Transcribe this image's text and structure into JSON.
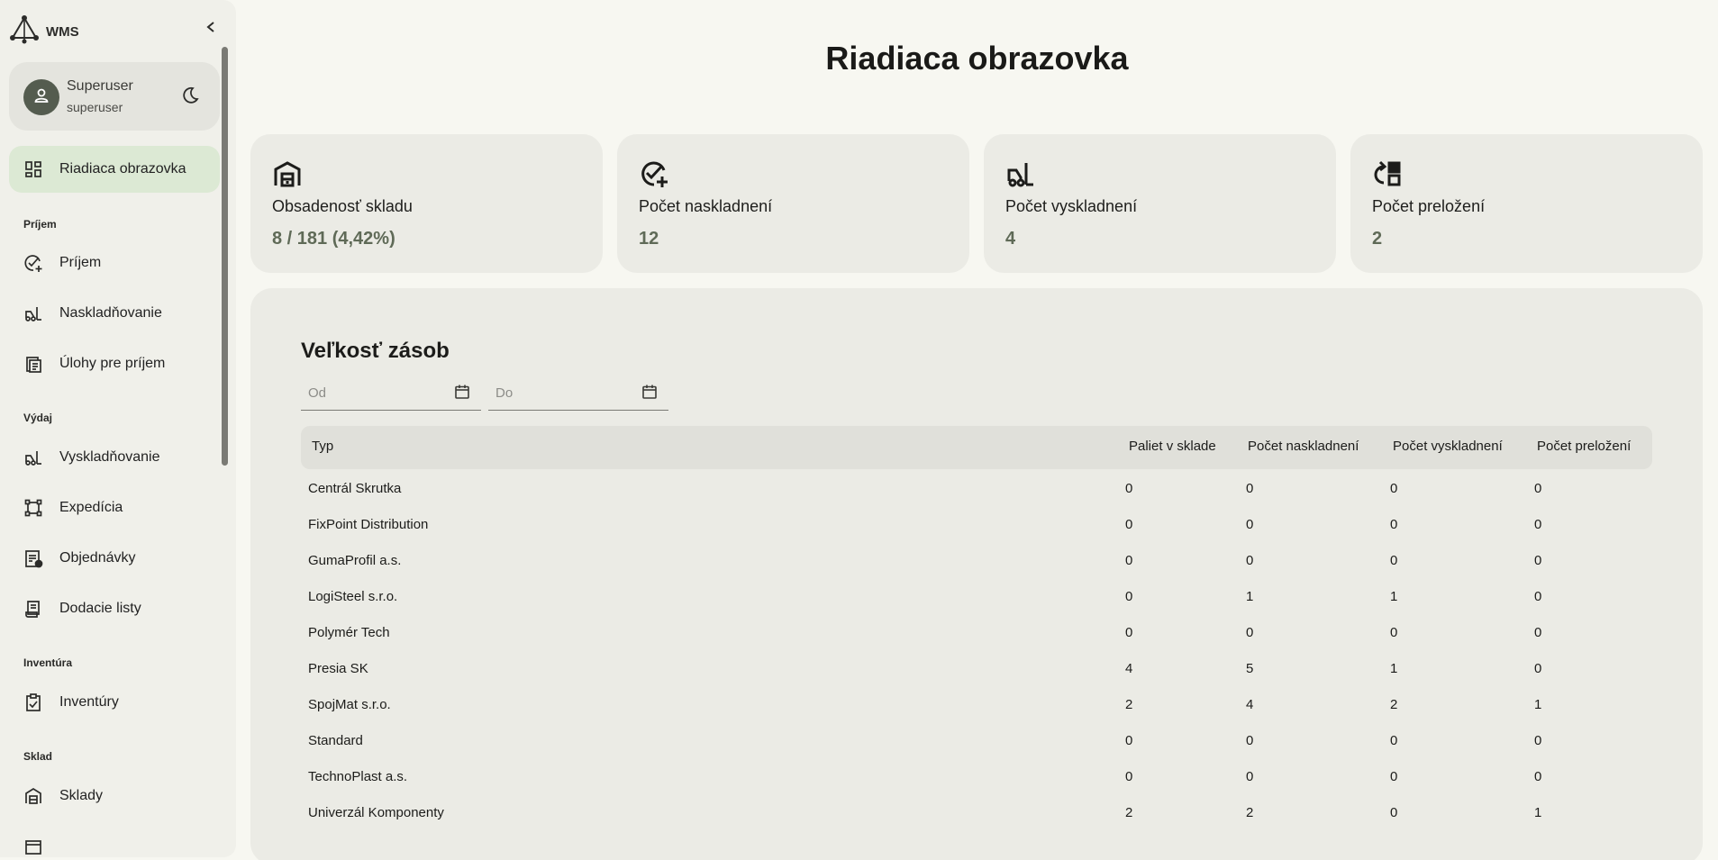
{
  "app": {
    "brand": "WMS"
  },
  "user": {
    "name": "Superuser",
    "login": "superuser"
  },
  "nav": {
    "dashboard": "Riadiaca obrazovka",
    "section_prijem": "Príjem",
    "prijem": "Príjem",
    "naskladnovanie": "Naskladňovanie",
    "ulohy": "Úlohy pre príjem",
    "section_vydaj": "Výdaj",
    "vyskladnovanie": "Vyskladňovanie",
    "expedicia": "Expedícia",
    "objednavky": "Objednávky",
    "dodacie": "Dodacie listy",
    "section_inventura": "Inventúra",
    "inventury": "Inventúry",
    "section_sklad": "Sklad",
    "sklady": "Sklady"
  },
  "page": {
    "title": "Riadiaca obrazovka"
  },
  "stats": [
    {
      "label": "Obsadenosť skladu",
      "value": "8 / 181 (4,42%)",
      "icon": "warehouse-icon"
    },
    {
      "label": "Počet naskladnení",
      "value": "12",
      "icon": "check-add-icon"
    },
    {
      "label": "Počet vyskladnení",
      "value": "4",
      "icon": "forklift-icon"
    },
    {
      "label": "Počet preložení",
      "value": "2",
      "icon": "relocate-icon"
    }
  ],
  "stock": {
    "title": "Veľkosť zásob",
    "from_placeholder": "Od",
    "to_placeholder": "Do",
    "columns": [
      "Typ",
      "Paliet v sklade",
      "Počet naskladnení",
      "Počet vyskladnení",
      "Počet preložení"
    ],
    "rows": [
      [
        "Centrál Skrutka",
        "0",
        "0",
        "0",
        "0"
      ],
      [
        "FixPoint Distribution",
        "0",
        "0",
        "0",
        "0"
      ],
      [
        "GumaProfil a.s.",
        "0",
        "0",
        "0",
        "0"
      ],
      [
        "LogiSteel s.r.o.",
        "0",
        "1",
        "1",
        "0"
      ],
      [
        "Polymér Tech",
        "0",
        "0",
        "0",
        "0"
      ],
      [
        "Presia SK",
        "4",
        "5",
        "1",
        "0"
      ],
      [
        "SpojMat s.r.o.",
        "2",
        "4",
        "2",
        "1"
      ],
      [
        "Standard",
        "0",
        "0",
        "0",
        "0"
      ],
      [
        "TechnoPlast a.s.",
        "0",
        "0",
        "0",
        "0"
      ],
      [
        "Univerzál Komponenty",
        "2",
        "2",
        "0",
        "1"
      ]
    ]
  },
  "colors": {
    "accent": "#dce9d4",
    "surface": "#ebebe5",
    "background": "#f7f7f1",
    "value_text": "#5f6a57"
  }
}
